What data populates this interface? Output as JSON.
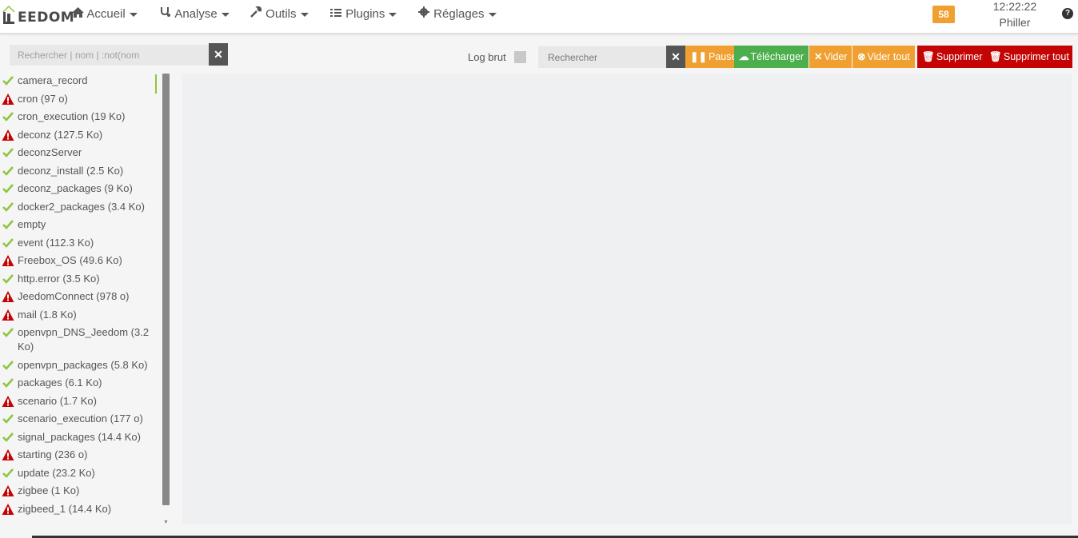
{
  "navbar": {
    "logo_text": "EEDOM",
    "menus": [
      {
        "label": "Accueil",
        "icon": "home-icon"
      },
      {
        "label": "Analyse",
        "icon": "stethoscope-icon"
      },
      {
        "label": "Outils",
        "icon": "wrench-icon"
      },
      {
        "label": "Plugins",
        "icon": "tasks-icon"
      },
      {
        "label": "Réglages",
        "icon": "gear-icon"
      }
    ],
    "notification_count": "58",
    "time": "12:22:22",
    "user": "Philler",
    "help_icon": "question-circle-icon"
  },
  "sidebar": {
    "search_placeholder": "Rechercher | nom | :not(nom",
    "logs": [
      {
        "name": "camera_record",
        "status": "ok"
      },
      {
        "name": "cron (97 o)",
        "status": "error"
      },
      {
        "name": "cron_execution (19 Ko)",
        "status": "ok"
      },
      {
        "name": "deconz (127.5 Ko)",
        "status": "error"
      },
      {
        "name": "deconzServer",
        "status": "ok"
      },
      {
        "name": "deconz_install (2.5 Ko)",
        "status": "ok"
      },
      {
        "name": "deconz_packages (9 Ko)",
        "status": "ok"
      },
      {
        "name": "docker2_packages (3.4 Ko)",
        "status": "ok"
      },
      {
        "name": "empty",
        "status": "ok"
      },
      {
        "name": "event (112.3 Ko)",
        "status": "ok"
      },
      {
        "name": "Freebox_OS (49.6 Ko)",
        "status": "error"
      },
      {
        "name": "http.error (3.5 Ko)",
        "status": "ok"
      },
      {
        "name": "JeedomConnect (978 o)",
        "status": "error"
      },
      {
        "name": "mail (1.8 Ko)",
        "status": "error"
      },
      {
        "name": "openvpn_DNS_Jeedom (3.2 Ko)",
        "status": "ok"
      },
      {
        "name": "openvpn_packages (5.8 Ko)",
        "status": "ok"
      },
      {
        "name": "packages (6.1 Ko)",
        "status": "ok"
      },
      {
        "name": "scenario (1.7 Ko)",
        "status": "error"
      },
      {
        "name": "scenario_execution (177 o)",
        "status": "ok"
      },
      {
        "name": "signal_packages (14.4 Ko)",
        "status": "ok"
      },
      {
        "name": "starting (236 o)",
        "status": "error"
      },
      {
        "name": "update (23.2 Ko)",
        "status": "ok"
      },
      {
        "name": "zigbee (1 Ko)",
        "status": "error"
      },
      {
        "name": "zigbeed_1 (14.4 Ko)",
        "status": "error"
      }
    ]
  },
  "toolbar": {
    "log_brut_label": "Log brut",
    "search_placeholder": "Rechercher",
    "pause_label": "Pause",
    "download_label": "Télécharger",
    "clear_label": "Vider",
    "clear_all_label": "Vider tout",
    "delete_label": "Supprimer",
    "delete_all_label": "Supprimer tout"
  },
  "colors": {
    "orange": "#f0a030",
    "green": "#4cae4c",
    "red": "#c40404",
    "ok_check": "#8dc63f",
    "error_triangle": "#c40404"
  }
}
